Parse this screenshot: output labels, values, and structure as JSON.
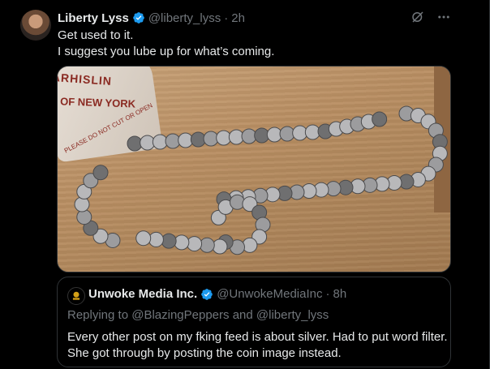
{
  "tweet": {
    "author_name": "Liberty Lyss",
    "handle": "@liberty_lyss",
    "separator": "·",
    "time": "2h",
    "text_lines": [
      "Get used to it.",
      "I suggest you lube up for what’s coming."
    ],
    "media": {
      "bag_text_line1": "ARHISLIN",
      "bag_text_line2": "OF NEW YORK",
      "bag_text_line3": "PLEASE DO NOT CUT OR OPEN"
    }
  },
  "quoted": {
    "author_name": "Unwoke Media Inc.",
    "handle": "@UnwokeMediaInc",
    "separator": "·",
    "time": "8h",
    "reply_prefix": "Replying to",
    "reply_user1": "@BlazingPeppers",
    "reply_and": "and",
    "reply_user2": "@liberty_lyss",
    "text_lines": [
      "Every other post on my fking feed is about silver. Had to put word filter.",
      "She got through by posting the coin image instead."
    ]
  },
  "icons": {
    "verified": "verified-badge-icon",
    "grok": "grok-icon",
    "more": "more-icon"
  },
  "colors": {
    "verified": "#1d9bf0",
    "secondary_text": "#71767b",
    "border": "#2f3336"
  }
}
